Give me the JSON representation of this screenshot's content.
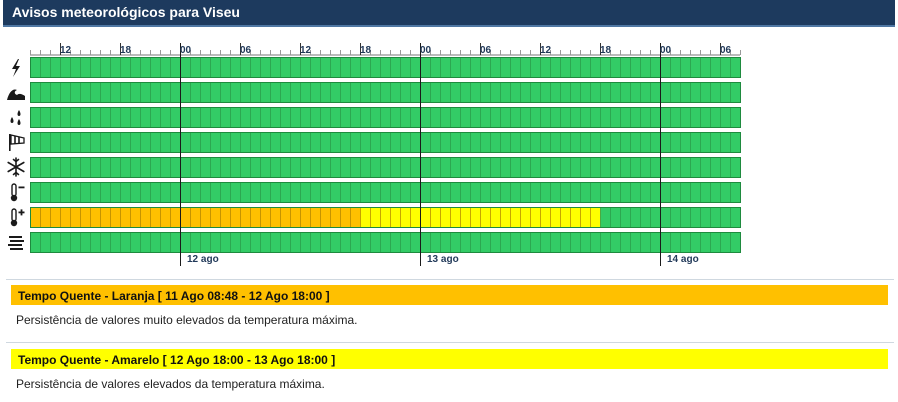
{
  "header": {
    "title": "Avisos meteorológicos para Viseu"
  },
  "timeline": {
    "hour_ticks": [
      "12",
      "18",
      "00",
      "06",
      "12",
      "18",
      "00",
      "06",
      "12",
      "18",
      "00",
      "06"
    ],
    "day_labels": [
      "12 ago",
      "13 ago",
      "14 ago"
    ],
    "colors": {
      "green": "#33cc66",
      "orange": "#ffc000",
      "yellow": "#ffff00"
    },
    "rows": [
      {
        "icon": "lightning-icon",
        "warning": "none"
      },
      {
        "icon": "coastal-waves-icon",
        "warning": "none"
      },
      {
        "icon": "rain-drops-icon",
        "warning": "none"
      },
      {
        "icon": "wind-sock-icon",
        "warning": "none"
      },
      {
        "icon": "snowflake-icon",
        "warning": "none"
      },
      {
        "icon": "thermometer-cold-icon",
        "warning": "none"
      },
      {
        "icon": "thermometer-hot-icon",
        "warning": "hot-weather"
      },
      {
        "icon": "fog-icon",
        "warning": "none"
      }
    ]
  },
  "warnings": [
    {
      "level": "orange",
      "color": "#ffc000",
      "title": "Tempo Quente - Laranja [ 11 Ago 08:48 - 12 Ago 18:00 ]",
      "description": "Persistência de valores muito elevados da temperatura máxima."
    },
    {
      "level": "yellow",
      "color": "#ffff00",
      "title": "Tempo Quente - Amarelo [ 12 Ago 18:00 - 13 Ago 18:00 ]",
      "description": "Persistência de valores elevados da temperatura máxima."
    }
  ]
}
